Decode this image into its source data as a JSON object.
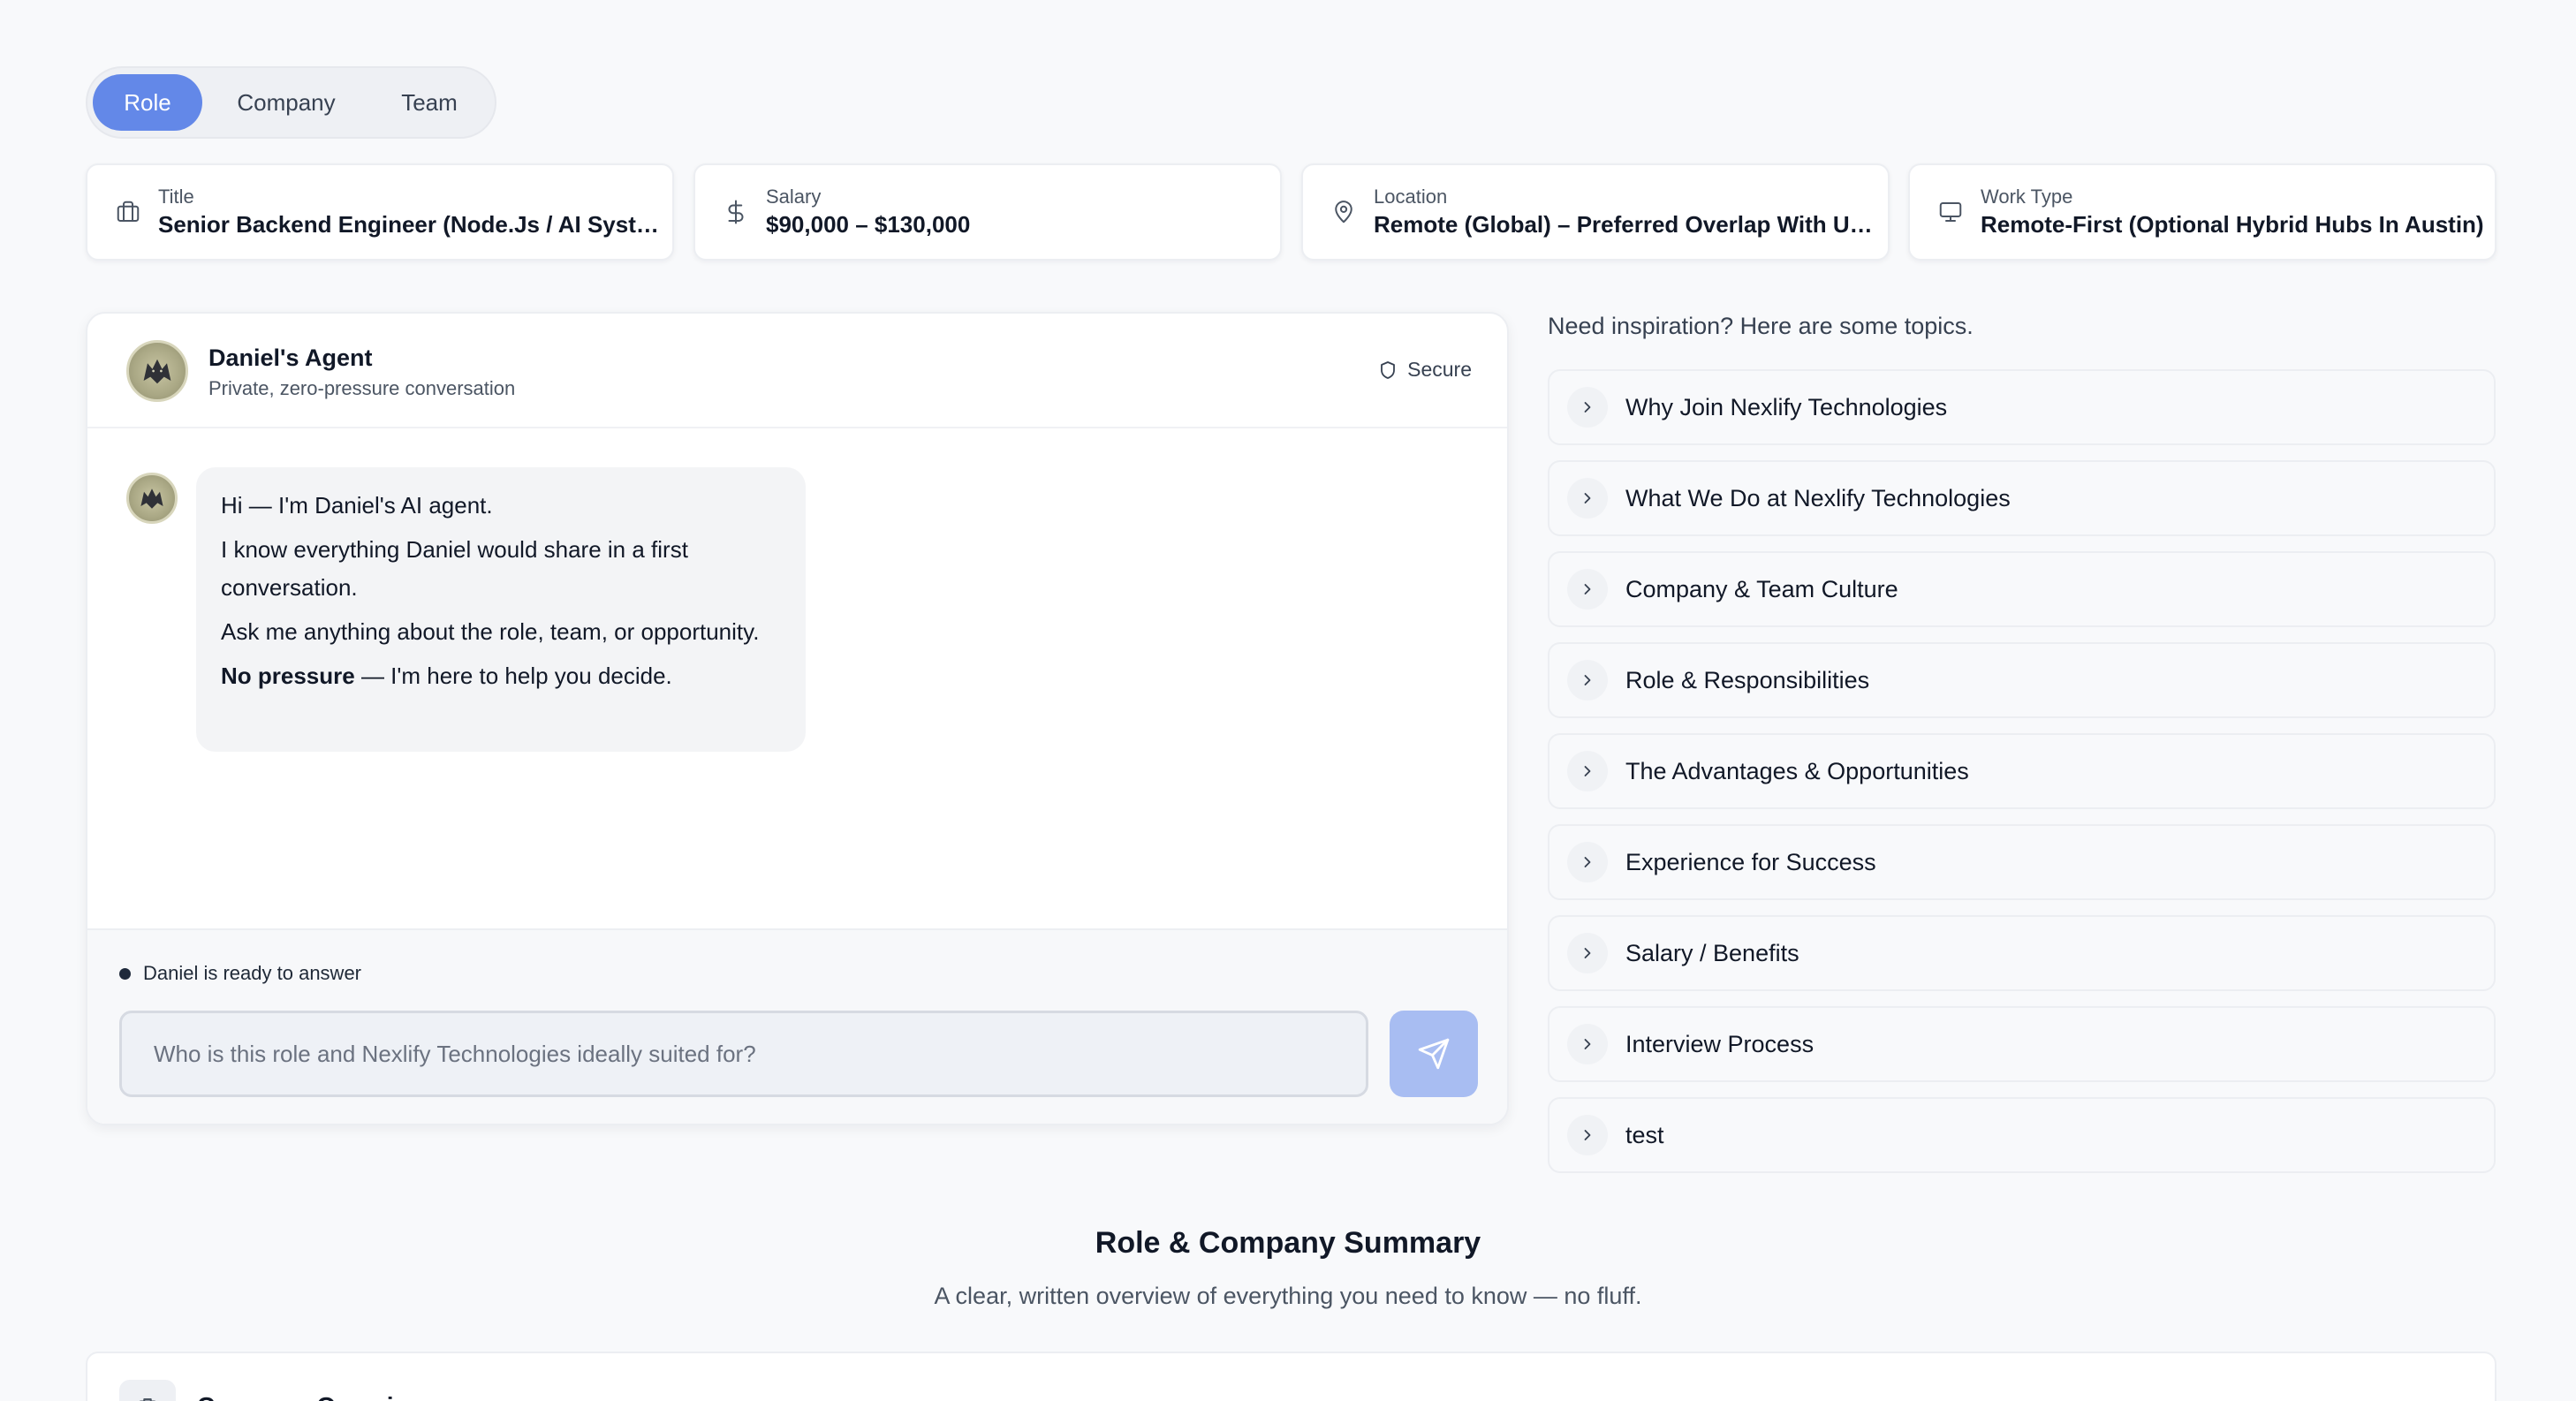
{
  "tabs": [
    {
      "label": "Role",
      "active": true
    },
    {
      "label": "Company",
      "active": false
    },
    {
      "label": "Team",
      "active": false
    }
  ],
  "info_cards": [
    {
      "label": "Title",
      "value": "Senior Backend Engineer (Node.Js / AI Systems)",
      "icon": "briefcase-icon"
    },
    {
      "label": "Salary",
      "value": "$90,000 – $130,000",
      "icon": "dollar-icon"
    },
    {
      "label": "Location",
      "value": "Remote (Global) – Preferred Overlap With US Time Zones",
      "icon": "map-pin-icon"
    },
    {
      "label": "Work Type",
      "value": "Remote-First (Optional Hybrid Hubs In Austin)",
      "icon": "monitor-icon"
    }
  ],
  "chat": {
    "agent_name": "Daniel's Agent",
    "agent_subtitle": "Private, zero-pressure conversation",
    "secure_label": "Secure",
    "message": {
      "line1": "Hi — I'm Daniel's AI agent.",
      "line2": "I know everything Daniel would share in a first conversation.",
      "line3": "Ask me anything about the role, team, or opportunity.",
      "line4_bold": "No pressure",
      "line4_rest": " — I'm here to help you decide."
    },
    "status": "Daniel is ready to answer",
    "input_placeholder": "Who is this role and Nexlify Technologies ideally suited for?",
    "input_value": ""
  },
  "topics": {
    "title": "Need inspiration? Here are some topics.",
    "items": [
      "Why Join Nexlify Technologies",
      "What We Do at Nexlify Technologies",
      "Company & Team Culture",
      "Role & Responsibilities",
      "The Advantages & Opportunities",
      "Experience for Success",
      "Salary / Benefits",
      "Interview Process",
      "test"
    ]
  },
  "summary": {
    "title": "Role & Company Summary",
    "subtitle": "A clear, written overview of everything you need to know — no fluff.",
    "card_title": "Company Overview"
  },
  "colors": {
    "accent": "#6388e8",
    "send_button": "#a8bdf2",
    "background": "#f8f9fb"
  }
}
